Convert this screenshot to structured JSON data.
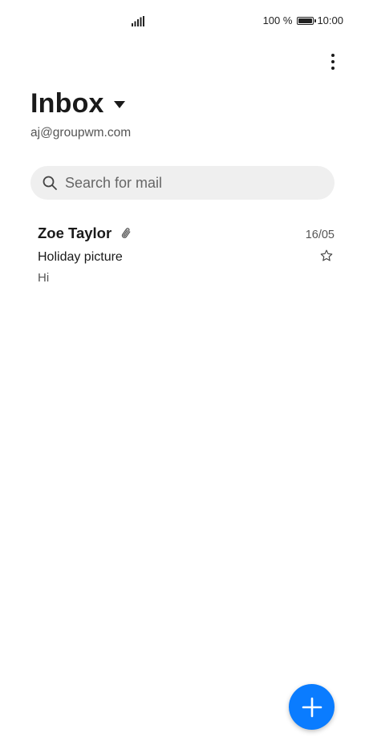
{
  "status_bar": {
    "battery": "100 %",
    "time": "10:00",
    "signal_icon": "signal-bars-icon",
    "battery_icon": "battery-full-icon"
  },
  "header": {
    "title": "Inbox",
    "account": "aj@groupwm.com",
    "dropdown_icon": "triangle-down-icon",
    "menu_icon": "more-vertical-icon"
  },
  "search": {
    "placeholder": "Search for mail",
    "value": ""
  },
  "mails": [
    {
      "sender": "Zoe Taylor",
      "has_attachment": true,
      "date": "16/05",
      "subject": "Holiday picture",
      "preview": "Hi",
      "starred": false
    }
  ],
  "fab": {
    "icon": "plus-icon",
    "color": "#0a7cff"
  }
}
